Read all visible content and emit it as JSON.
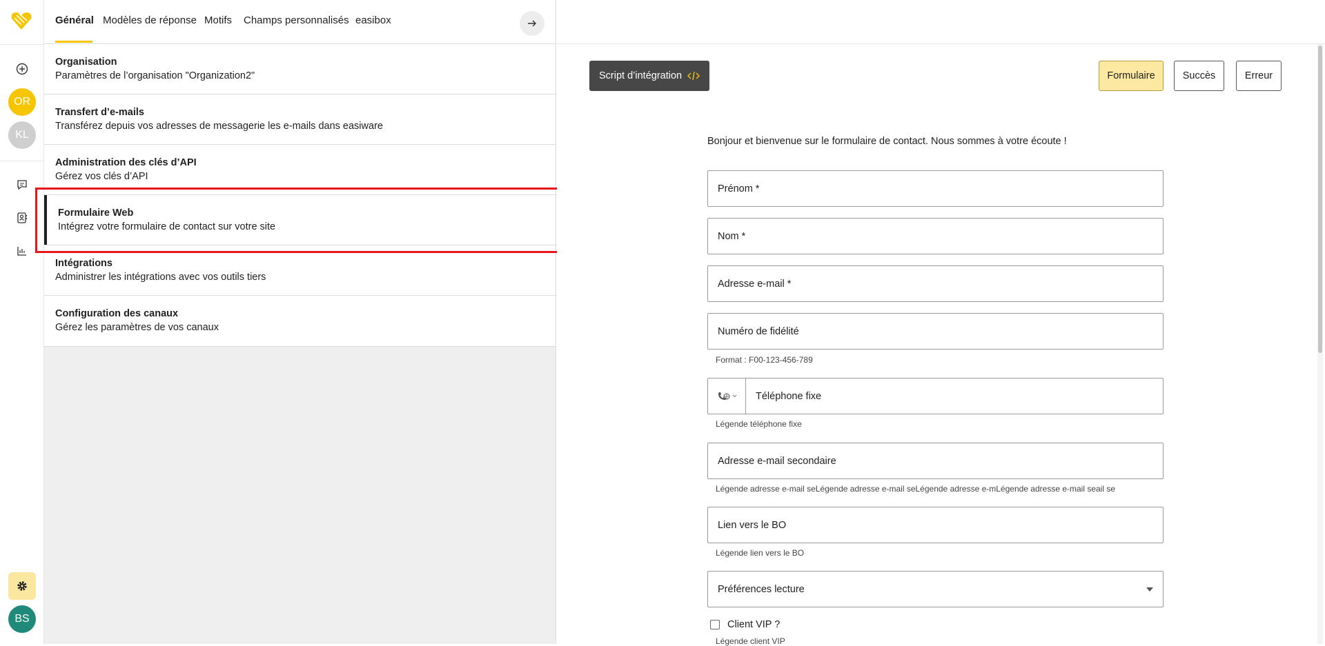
{
  "rail": {
    "avatars": [
      {
        "initials": "OR",
        "color": "#f6c500"
      },
      {
        "initials": "KL",
        "color": "#cfcfcf"
      },
      {
        "initials": "BS",
        "color": "#1f8a7a"
      }
    ],
    "icons": [
      "logo-icon",
      "add-icon",
      "chat-icon",
      "contacts-icon",
      "stats-icon",
      "settings-icon"
    ]
  },
  "tabs": [
    "Général",
    "Modèles de réponse",
    "Motifs",
    "Champs personnalisés",
    "easibox"
  ],
  "menu": [
    {
      "title": "Organisation",
      "desc": "Paramètres de l’organisation \"Organization2\""
    },
    {
      "title": "Transfert d’e-mails",
      "desc": "Transférez depuis vos adresses de messagerie les e-mails dans easiware"
    },
    {
      "title": "Administration des clés d’API",
      "desc": "Gérez vos clés d’API"
    },
    {
      "title": "Formulaire Web",
      "desc": "Intégrez votre formulaire de contact sur votre site"
    },
    {
      "title": "Intégrations",
      "desc": "Administrer les intégrations avec vos outils tiers"
    },
    {
      "title": "Configuration des canaux",
      "desc": "Gérez les paramètres de vos canaux"
    }
  ],
  "toolbar": {
    "script_label": "Script d’intégration",
    "form_label": "Formulaire",
    "success_label": "Succès",
    "error_label": "Erreur"
  },
  "form": {
    "welcome": "Bonjour et bienvenue sur le formulaire de contact. Nous sommes à votre écoute !",
    "firstname": "Prénom *",
    "lastname": "Nom *",
    "email": "Adresse e-mail *",
    "loyalty": "Numéro de fidélité",
    "loyalty_legend": "Format : F00-123-456-789",
    "phone": "Téléphone fixe",
    "phone_legend": "Légende téléphone fixe",
    "email2": "Adresse e-mail secondaire",
    "email2_legend": "Légende adresse e-mail seLégende adresse e-mail seLégende adresse e-mLégende adresse e-mail seail se",
    "bo_link": "Lien vers le BO",
    "bo_legend": "Légende lien vers le BO",
    "reading": "Préférences lecture",
    "vip": "Client VIP ?",
    "vip_legend": "Légende client VIP"
  }
}
